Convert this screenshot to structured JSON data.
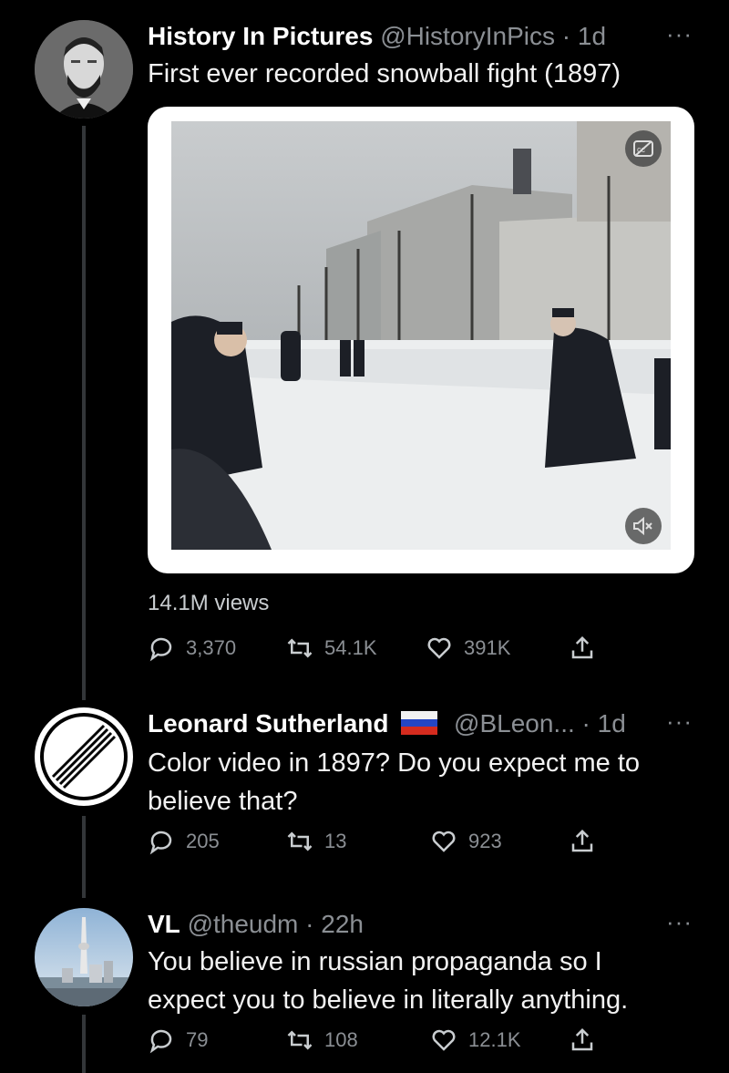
{
  "tweets": [
    {
      "name": "History In Pictures",
      "handle": "@HistoryInPics",
      "time": "· 1d",
      "text": "First ever recorded snowball fight (1897)",
      "views": "14.1M views",
      "replies": "3,370",
      "retweets": "54.1K",
      "likes": "391K"
    },
    {
      "name": "Leonard Sutherland",
      "handle": "@BLeon...",
      "time": "· 1d",
      "text_line1": "Color video in 1897?  Do you expect me to",
      "text_line2": "believe that?",
      "replies": "205",
      "retweets": "13",
      "likes": "923"
    },
    {
      "name": "VL",
      "handle": "@theudm",
      "time": "· 22h",
      "text_line1": "You believe in russian propaganda so I",
      "text_line2": "expect you to believe in literally anything.",
      "replies": "79",
      "retweets": "108",
      "likes": "12.1K"
    }
  ],
  "icons": {
    "more": "more-horizontal-icon",
    "reply": "reply-bubble-icon",
    "retweet": "retweet-arrows-icon",
    "like": "heart-icon",
    "share": "share-upload-icon",
    "video_caption": "closed-caption-icon",
    "video_mute": "muted-speaker-icon",
    "flag": "russia-flag-emoji"
  },
  "more_glyph": "···",
  "colors": {
    "background": "#000000",
    "secondary_text": "#8b8f94",
    "thread_line": "#333639"
  }
}
